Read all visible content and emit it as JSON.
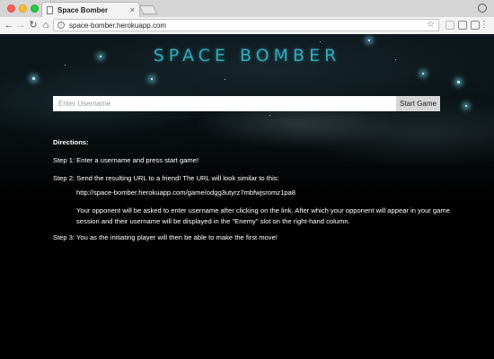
{
  "browser": {
    "tab_title": "Space Bomber",
    "tab_close": "×",
    "url": "space-bomber.herokuapp.com",
    "icons": {
      "back": "←",
      "forward": "→",
      "reload": "↻",
      "home": "⌂",
      "info": "i",
      "star": "☆",
      "menu": "⋮"
    }
  },
  "page": {
    "logo": "SPACE BOMBER",
    "username_placeholder": "Enter Username",
    "start_label": "Start Game",
    "directions": {
      "title": "Directions:",
      "step1": "Step 1: Enter a username and press start game!",
      "step2": "Step 2: Send the resulting URL to a friend! The URL will look similar to this:",
      "example_url": "http://space-bomber.herokuapp.com/game/odgg3utyrz7mbfwjsromz1pa8",
      "note_line1": "Your opponent will be asked to enter username after clicking on the link. After which your opponent will appear in your game",
      "note_line2": "session and their username will be displayed in the \"Enemy\" slot on the right-hand column.",
      "step3": "Step 3: You as the initiating player will then be able to make the first move!"
    }
  },
  "colors": {
    "logo": "#38a6b8",
    "background": "#000000",
    "button": "#d6d6d6"
  }
}
